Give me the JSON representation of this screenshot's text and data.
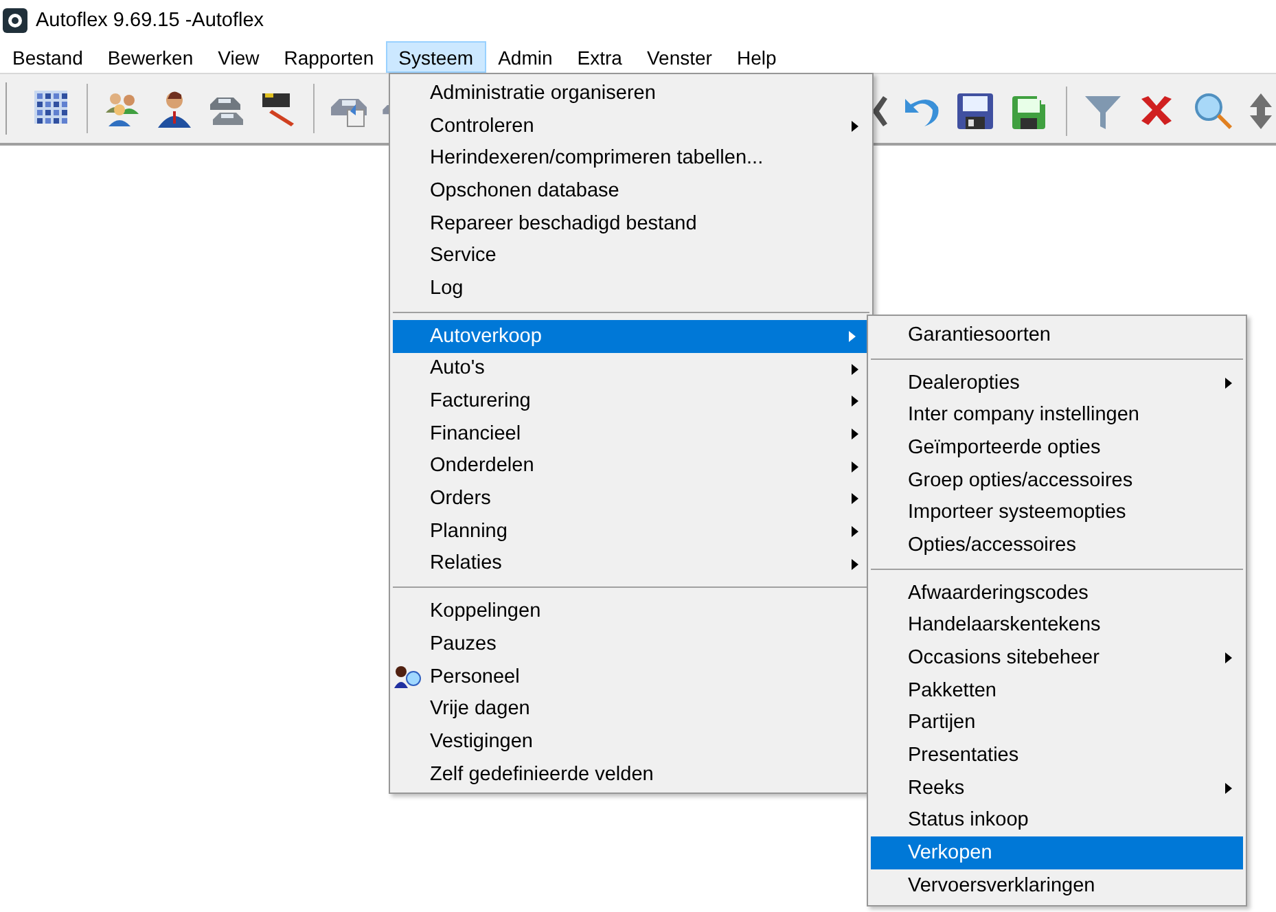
{
  "window": {
    "title": "Autoflex 9.69.15 -Autoflex"
  },
  "menubar": [
    {
      "label": "Bestand",
      "selected": false
    },
    {
      "label": "Bewerken",
      "selected": false
    },
    {
      "label": "View",
      "selected": false
    },
    {
      "label": "Rapporten",
      "selected": false
    },
    {
      "label": "Systeem",
      "selected": true
    },
    {
      "label": "Admin",
      "selected": false
    },
    {
      "label": "Extra",
      "selected": false
    },
    {
      "label": "Venster",
      "selected": false
    },
    {
      "label": "Help",
      "selected": false
    }
  ],
  "systeem_menu": {
    "groups": [
      [
        {
          "label": "Administratie organiseren",
          "has_submenu": false,
          "selected": false
        },
        {
          "label": "Controleren",
          "has_submenu": true,
          "selected": false
        },
        {
          "label": "Herindexeren/comprimeren tabellen...",
          "has_submenu": false,
          "selected": false
        },
        {
          "label": "Opschonen database",
          "has_submenu": false,
          "selected": false
        },
        {
          "label": "Repareer beschadigd bestand",
          "has_submenu": false,
          "selected": false
        },
        {
          "label": "Service",
          "has_submenu": false,
          "selected": false
        },
        {
          "label": "Log",
          "has_submenu": false,
          "selected": false
        }
      ],
      [
        {
          "label": "Autoverkoop",
          "has_submenu": true,
          "selected": true
        },
        {
          "label": "Auto's",
          "has_submenu": true,
          "selected": false
        },
        {
          "label": "Facturering",
          "has_submenu": true,
          "selected": false
        },
        {
          "label": "Financieel",
          "has_submenu": true,
          "selected": false
        },
        {
          "label": "Onderdelen",
          "has_submenu": true,
          "selected": false
        },
        {
          "label": "Orders",
          "has_submenu": true,
          "selected": false
        },
        {
          "label": "Planning",
          "has_submenu": true,
          "selected": false
        },
        {
          "label": "Relaties",
          "has_submenu": true,
          "selected": false
        }
      ],
      [
        {
          "label": "Koppelingen",
          "has_submenu": false,
          "selected": false
        },
        {
          "label": "Pauzes",
          "has_submenu": false,
          "selected": false
        },
        {
          "label": "Personeel",
          "has_submenu": false,
          "selected": false,
          "has_icon": true
        },
        {
          "label": "Vrije dagen",
          "has_submenu": false,
          "selected": false
        },
        {
          "label": "Vestigingen",
          "has_submenu": false,
          "selected": false
        },
        {
          "label": "Zelf gedefinieerde velden",
          "has_submenu": false,
          "selected": false
        }
      ]
    ]
  },
  "autoverkoop_submenu": {
    "groups": [
      [
        {
          "label": "Garantiesoorten",
          "has_submenu": false,
          "selected": false
        }
      ],
      [
        {
          "label": "Dealeropties",
          "has_submenu": true,
          "selected": false
        },
        {
          "label": "Inter company instellingen",
          "has_submenu": false,
          "selected": false
        },
        {
          "label": "Geïmporteerde opties",
          "has_submenu": false,
          "selected": false
        },
        {
          "label": "Groep opties/accessoires",
          "has_submenu": false,
          "selected": false
        },
        {
          "label": "Importeer systeemopties",
          "has_submenu": false,
          "selected": false
        },
        {
          "label": "Opties/accessoires",
          "has_submenu": false,
          "selected": false
        }
      ],
      [
        {
          "label": "Afwaarderingscodes",
          "has_submenu": false,
          "selected": false
        },
        {
          "label": "Handelaarskentekens",
          "has_submenu": false,
          "selected": false
        },
        {
          "label": "Occasions sitebeheer",
          "has_submenu": true,
          "selected": false
        },
        {
          "label": "Pakketten",
          "has_submenu": false,
          "selected": false
        },
        {
          "label": "Partijen",
          "has_submenu": false,
          "selected": false
        },
        {
          "label": "Presentaties",
          "has_submenu": false,
          "selected": false
        },
        {
          "label": "Reeks",
          "has_submenu": true,
          "selected": false
        },
        {
          "label": "Status inkoop",
          "has_submenu": false,
          "selected": false
        },
        {
          "label": "Verkopen",
          "has_submenu": false,
          "selected": true
        },
        {
          "label": "Vervoersverklaringen",
          "has_submenu": false,
          "selected": false
        }
      ]
    ]
  }
}
